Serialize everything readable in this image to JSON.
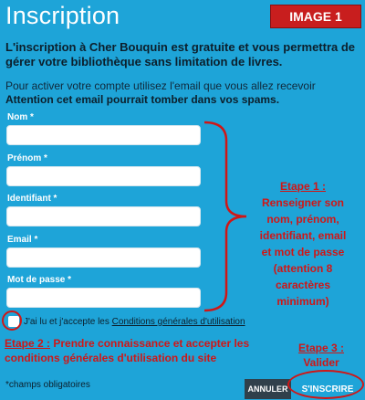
{
  "header": {
    "title": "Inscription",
    "badge": "IMAGE 1"
  },
  "intro": {
    "bold_text": "L'inscription à Cher Bouquin est gratuite et vous permettra de gérer votre bibliothèque sans limitation de livres.",
    "info_text": "Pour activer votre compte utilisez l'email que vous allez recevoir",
    "warning_text": "Attention cet email pourrait tomber dans vos spams."
  },
  "form": {
    "fields": [
      {
        "label": "Nom *",
        "value": ""
      },
      {
        "label": "Prénom *",
        "value": ""
      },
      {
        "label": "Identifiant *",
        "value": ""
      },
      {
        "label": "Email *",
        "value": ""
      },
      {
        "label": "Mot de passe *",
        "value": ""
      }
    ],
    "terms_prefix": "J'ai lu et j'accepte les",
    "terms_link": "Conditions générales d'utilisation",
    "required_note": "*champs obligatoires",
    "cancel_label": "ANNULER",
    "submit_label": "S'INSCRIRE"
  },
  "annotations": {
    "step1_title": "Etape 1 :",
    "step1_text": "Renseigner son nom, prénom, identifiant, email et mot de passe (attention 8 caractères minimum)",
    "step2_title": "Etape 2 :",
    "step2_text": "Prendre connaissance et accepter les conditions générales d'utilisation du site",
    "step3_title": "Etape 3 :",
    "step3_text": "Valider"
  },
  "colors": {
    "background": "#1ea4d8",
    "annotation": "#d01616",
    "badge": "#c81e1e"
  }
}
